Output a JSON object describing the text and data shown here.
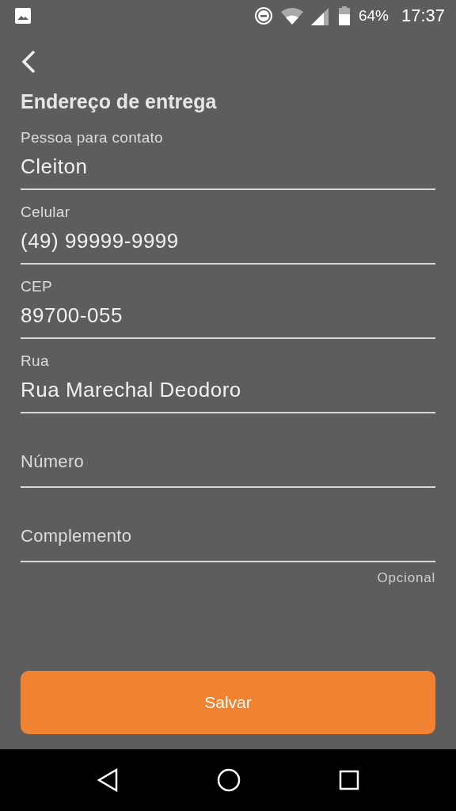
{
  "status_bar": {
    "battery": "64%",
    "time": "17:37"
  },
  "title": "Endereço de entrega",
  "fields": [
    {
      "label": "Pessoa para contato",
      "value": "Cleiton"
    },
    {
      "label": "Celular",
      "value": "(49) 99999-9999"
    },
    {
      "label": "CEP",
      "value": "89700-055"
    },
    {
      "label": "Rua",
      "value": "Rua Marechal Deodoro"
    },
    {
      "label": "Número"
    },
    {
      "label": "Complemento",
      "helper": "Opcional"
    }
  ],
  "button": "Salvar"
}
